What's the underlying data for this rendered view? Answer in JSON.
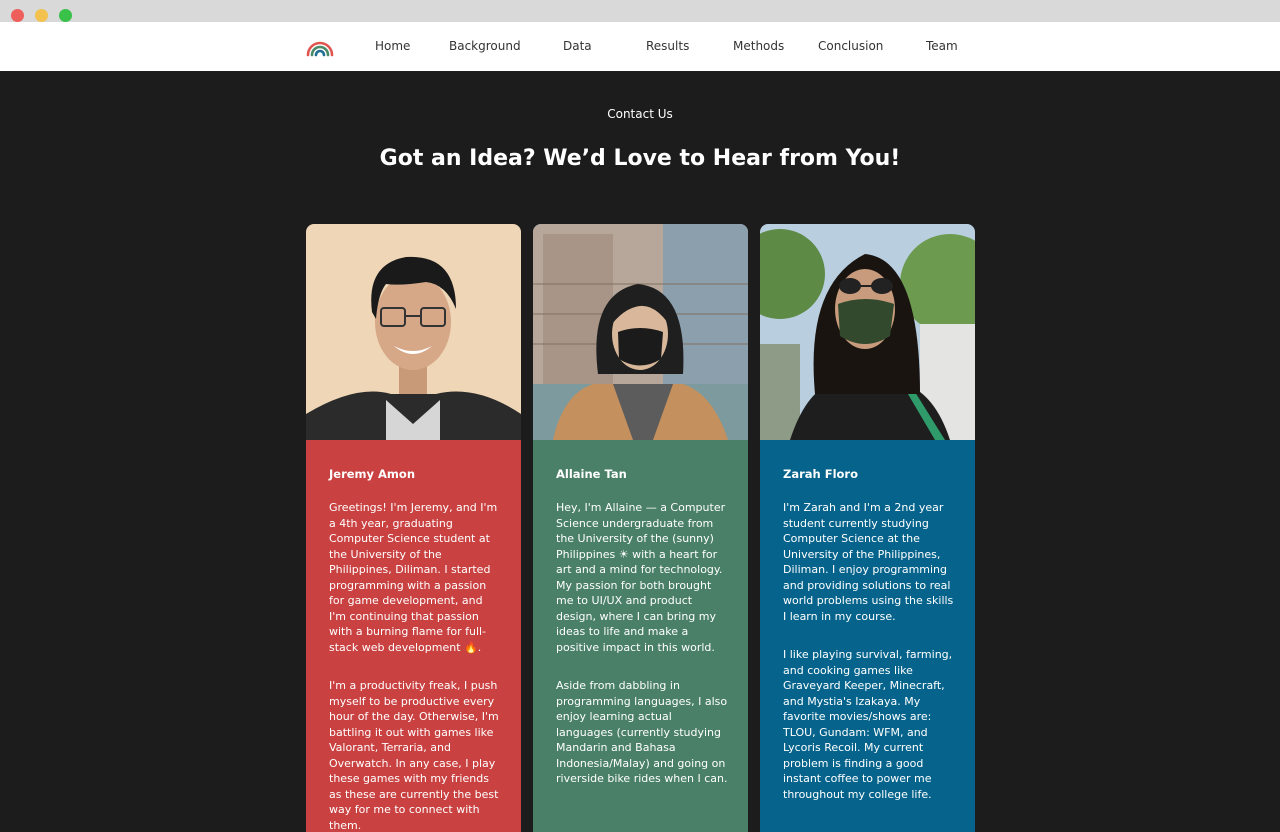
{
  "colors": {
    "page_background": "#1c1c1c",
    "card_red": "#c94141",
    "card_green": "#4a8068",
    "card_blue": "#06648c"
  },
  "nav": {
    "logo_icon": "concentric-rings-logo-icon",
    "items": [
      "Home",
      "Background",
      "Data",
      "Results",
      "Methods",
      "Conclusion",
      "Team"
    ]
  },
  "contact": {
    "eyebrow": "Contact Us",
    "headline": "Got an Idea? We’d Love to Hear from You!"
  },
  "team": [
    {
      "name": "Jeremy Amon",
      "photo": "portrait-photo",
      "paragraphs": [
        "Greetings! I'm Jeremy, and I'm a 4th year, graduating Computer Science student at the University of the Philippines, Diliman. I started programming with a passion for game development, and I'm continuing that passion with a burning flame for full-stack web development 🔥.",
        "I'm a productivity freak, I push myself to be productive every hour of the day. Otherwise, I'm battling it out with games like Valorant, Terraria, and Overwatch. In any case, I play these games with my friends as these are currently the best way for me to connect with them."
      ]
    },
    {
      "name": "Allaine Tan",
      "photo": "portrait-photo",
      "paragraphs": [
        "Hey, I'm Allaine — a Computer Science undergraduate from the University of the (sunny) Philippines ☀ with a heart for art and a mind for technology. My passion for both brought me to UI/UX and product design, where I can bring my ideas to life and make a positive impact in this world.",
        "Aside from dabbling in programming languages, I also enjoy learning actual languages (currently studying Mandarin and Bahasa Indonesia/Malay) and going on riverside bike rides when I can."
      ]
    },
    {
      "name": "Zarah Floro",
      "photo": "portrait-photo",
      "paragraphs": [
        "I'm Zarah and I'm a 2nd year student currently studying Computer Science at the University of the Philippines, Diliman. I enjoy programming and providing solutions to real world problems using the skills I learn in my course.",
        "I like playing survival, farming, and cooking games like Graveyard Keeper, Minecraft, and Mystia's Izakaya. My favorite movies/shows are: TLOU, Gundam: WFM, and Lycoris Recoil. My current problem is finding a good instant coffee to power me throughout my college life."
      ]
    }
  ]
}
